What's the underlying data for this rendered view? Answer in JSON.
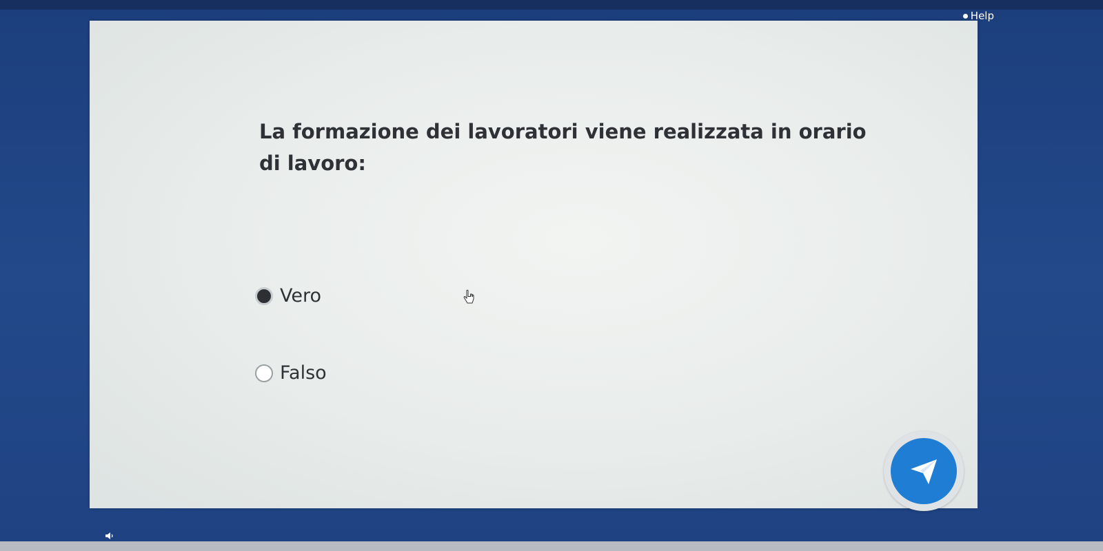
{
  "header": {
    "help_label": "Help"
  },
  "quiz": {
    "question": "La formazione dei lavoratori viene realizzata in orario di lavoro:",
    "options": [
      {
        "label": "Vero",
        "selected": true
      },
      {
        "label": "Falso",
        "selected": false
      }
    ]
  },
  "icons": {
    "submit": "send-icon",
    "volume": "volume-icon",
    "cursor": "hand-pointer-icon"
  },
  "colors": {
    "background": "#23498a",
    "submit_button": "#1f7dd4",
    "text": "#2f3136"
  }
}
